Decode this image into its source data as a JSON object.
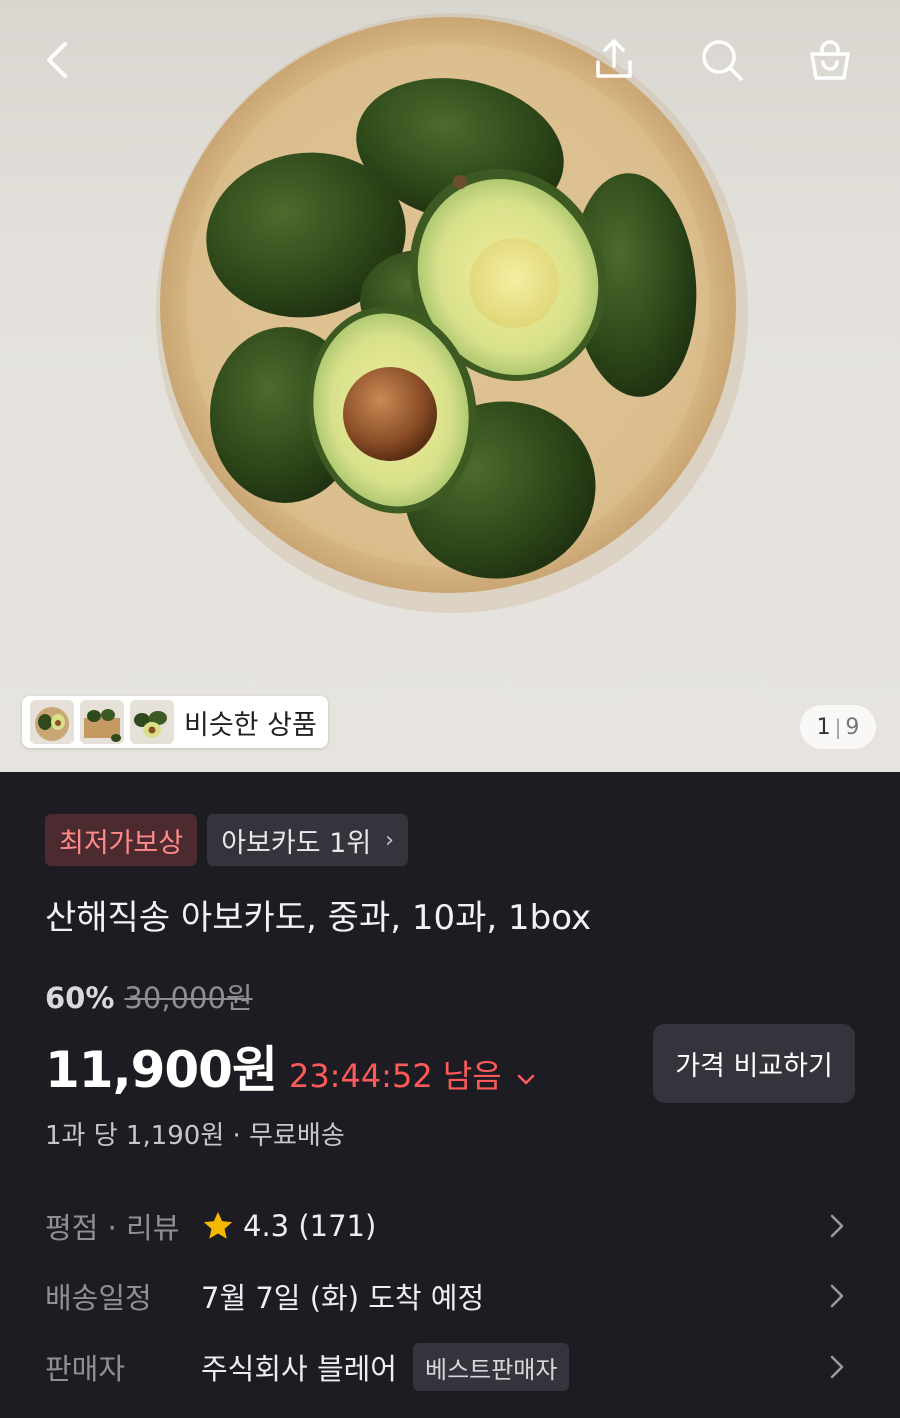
{
  "hero": {
    "similar_label": "비슷한 상품",
    "page_current": "1",
    "page_separator": "|",
    "page_total": "9"
  },
  "topbar": {
    "icons": [
      "back-chevron-icon",
      "share-icon",
      "search-icon",
      "cart-icon"
    ]
  },
  "badges": {
    "lowest_price": "최저가보상",
    "rank": "아보카도 1위"
  },
  "product": {
    "title": "산해직송 아보카도, 중과, 10과, 1box",
    "discount_percent": "60%",
    "original_price": "30,000원",
    "price": "11,900원",
    "timer": "23:44:52 남음",
    "compare_button": "가격 비교하기",
    "unit_info": "1과 당 1,190원 · 무료배송"
  },
  "info_rows": {
    "rating_label": "평점 · 리뷰",
    "rating_value": "4.3 (171)",
    "delivery_label": "배송일정",
    "delivery_value": "7월 7일 (화) 도착 예정",
    "seller_label": "판매자",
    "seller_value": "주식회사 블레어",
    "seller_badge": "베스트판매자"
  },
  "colors": {
    "background": "#1c1c22",
    "accent_red": "#ff5a5a",
    "star": "#f5b800"
  }
}
